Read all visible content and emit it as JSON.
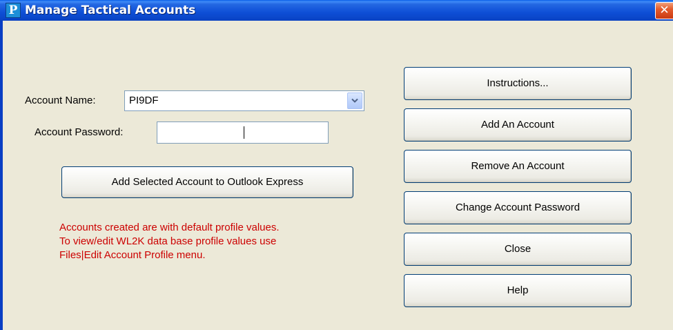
{
  "window": {
    "title": "Manage Tactical Accounts",
    "icon": "app-icon",
    "close_label": "✕"
  },
  "form": {
    "account_name_label": "Account Name:",
    "account_name_value": "PI9DF",
    "account_password_label": "Account Password:",
    "account_password_value": ""
  },
  "buttons": {
    "add_to_outlook": "Add Selected Account to Outlook Express",
    "instructions": "Instructions...",
    "add_account": "Add An Account",
    "remove_account": "Remove An Account",
    "change_password": "Change Account Password",
    "close": "Close",
    "help": "Help"
  },
  "note": {
    "lines": [
      "Accounts created are with default profile values.",
      "To view/edit WL2K data base profile values use",
      "Files|Edit Account Profile menu."
    ],
    "color": "#CC0000"
  },
  "colors": {
    "titlebar": "#0A45C8",
    "dialog_bg": "#ECE9D8",
    "button_border": "#003C74",
    "close_button": "#E45B2C"
  }
}
